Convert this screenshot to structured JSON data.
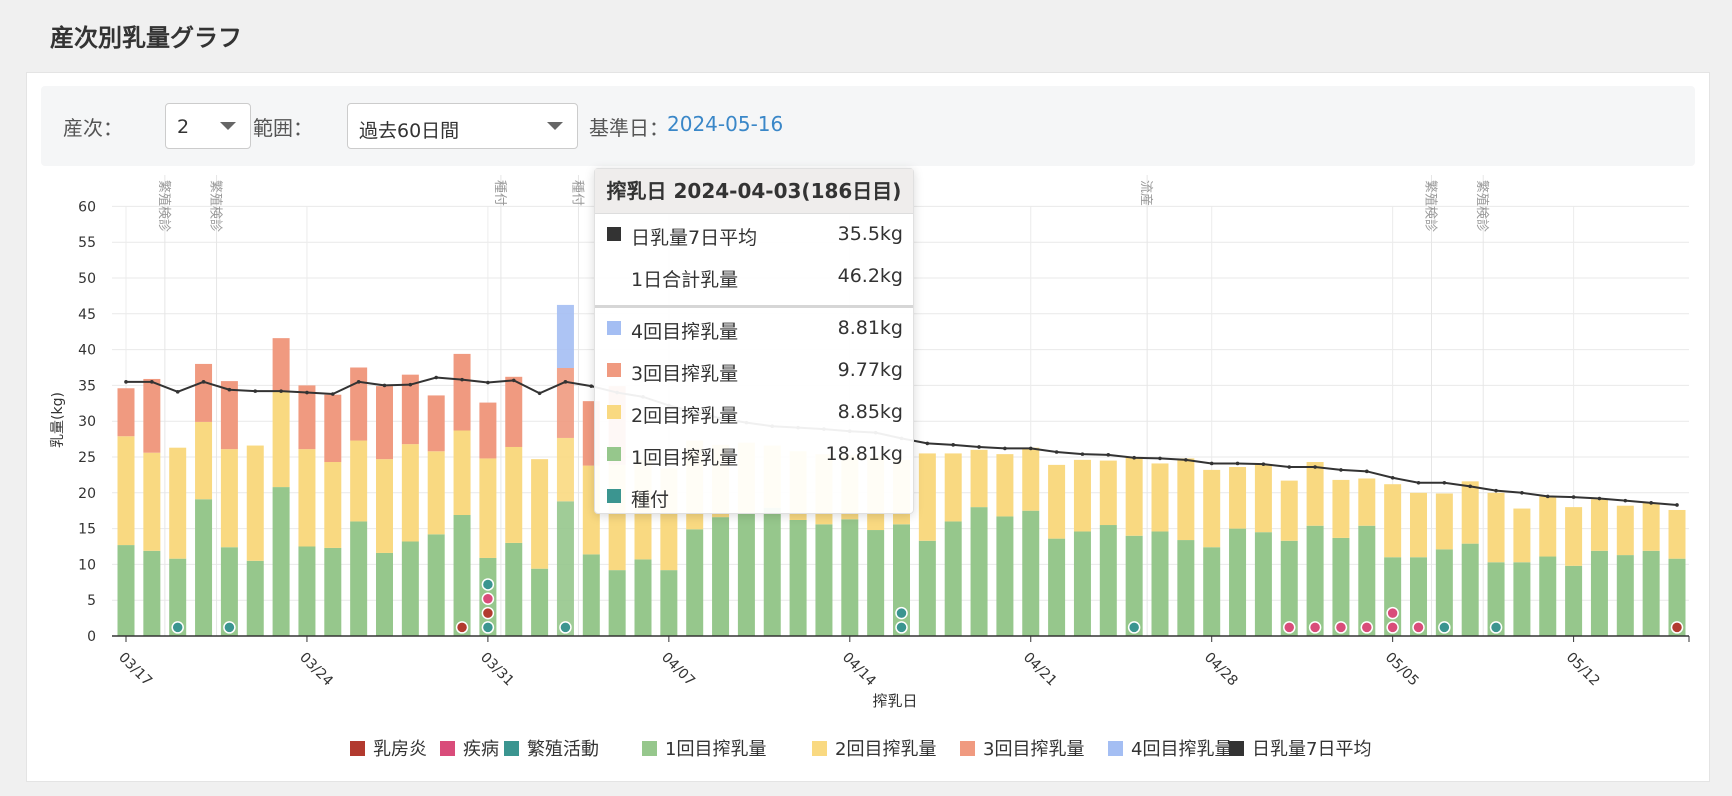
{
  "page_title": "産次別乳量グラフ",
  "filters": {
    "parity_label": "産次：",
    "parity_value": "2",
    "range_label": "範囲：",
    "range_value": "過去60日間",
    "base_date_label": "基準日：",
    "base_date_value": "2024-05-16"
  },
  "tooltip": {
    "title": "搾乳日 2024-04-03(186日目)",
    "rows": [
      {
        "name": "日乳量7日平均",
        "value": "35.5kg",
        "color": "#333333"
      },
      {
        "name": "1日合計乳量",
        "value": "46.2kg",
        "color": ""
      },
      {
        "name": "4回目搾乳量",
        "value": "8.81kg",
        "color": "#a4bef3"
      },
      {
        "name": "3回目搾乳量",
        "value": "9.77kg",
        "color": "#f09a80"
      },
      {
        "name": "2回目搾乳量",
        "value": "8.85kg",
        "color": "#f9d981"
      },
      {
        "name": "1回目搾乳量",
        "value": "18.81kg",
        "color": "#96c78c"
      },
      {
        "name": "種付",
        "value": "",
        "color": "#3b9590"
      }
    ]
  },
  "legend": [
    {
      "name": "乳房炎",
      "color": "#b23a2f"
    },
    {
      "name": "疾病",
      "color": "#d94c7a"
    },
    {
      "name": "繁殖活動",
      "color": "#3b9590"
    },
    {
      "name": "1回目搾乳量",
      "color": "#96c78c"
    },
    {
      "name": "2回目搾乳量",
      "color": "#f9d981"
    },
    {
      "name": "3回目搾乳量",
      "color": "#f09a80"
    },
    {
      "name": "4回目搾乳量",
      "color": "#a4bef3"
    },
    {
      "name": "日乳量7日平均",
      "color": "#333333"
    }
  ],
  "chart_data": {
    "type": "bar",
    "stacked": true,
    "xlabel": "搾乳日",
    "ylabel": "乳量(kg)",
    "ylim": [
      0,
      60
    ],
    "yticks": [
      0,
      5,
      10,
      15,
      20,
      25,
      30,
      35,
      40,
      45,
      50,
      55,
      60
    ],
    "x_tick_labels": [
      "03/17",
      "03/24",
      "03/31",
      "04/07",
      "04/14",
      "04/21",
      "04/28",
      "05/05",
      "05/12"
    ],
    "categories": [
      "03/17",
      "03/18",
      "03/19",
      "03/20",
      "03/21",
      "03/22",
      "03/23",
      "03/24",
      "03/25",
      "03/26",
      "03/27",
      "03/28",
      "03/29",
      "03/30",
      "03/31",
      "04/01",
      "04/02",
      "04/03",
      "04/04",
      "04/05",
      "04/06",
      "04/07",
      "04/08",
      "04/09",
      "04/10",
      "04/11",
      "04/12",
      "04/13",
      "04/14",
      "04/15",
      "04/16",
      "04/17",
      "04/18",
      "04/19",
      "04/20",
      "04/21",
      "04/22",
      "04/23",
      "04/24",
      "04/25",
      "04/26",
      "04/27",
      "04/28",
      "04/29",
      "04/30",
      "05/01",
      "05/02",
      "05/03",
      "05/04",
      "05/05",
      "05/06",
      "05/07",
      "05/08",
      "05/09",
      "05/10",
      "05/11",
      "05/12",
      "05/13",
      "05/14",
      "05/15",
      "05/16"
    ],
    "series": [
      {
        "name": "1回目搾乳量",
        "color": "#96c78c",
        "values": [
          12.7,
          11.9,
          10.8,
          19.1,
          12.4,
          10.5,
          20.8,
          12.5,
          12.3,
          16.0,
          11.6,
          13.2,
          14.2,
          16.9,
          10.9,
          13.0,
          9.4,
          18.81,
          11.4,
          9.2,
          10.7,
          9.2,
          14.9,
          16.6,
          17.2,
          17.9,
          16.2,
          15.6,
          16.3,
          14.8,
          15.6,
          13.3,
          16.0,
          18.0,
          16.7,
          17.5,
          13.6,
          14.6,
          15.5,
          14.0,
          14.6,
          13.4,
          12.4,
          15.0,
          14.5,
          13.3,
          15.4,
          13.7,
          15.4,
          11.0,
          11.0,
          12.1,
          12.9,
          10.3,
          10.3,
          11.1,
          9.8,
          11.9,
          11.3,
          11.9,
          10.8
        ]
      },
      {
        "name": "2回目搾乳量",
        "color": "#f9d981",
        "values": [
          15.2,
          13.7,
          15.5,
          10.8,
          13.7,
          16.1,
          13.5,
          13.6,
          12.0,
          11.3,
          13.1,
          13.6,
          11.6,
          11.8,
          13.9,
          13.4,
          15.3,
          8.85,
          12.4,
          14.7,
          13.9,
          14.2,
          12.4,
          10.1,
          9.8,
          8.7,
          9.6,
          9.8,
          9.0,
          10.2,
          9.0,
          12.2,
          9.5,
          8.0,
          8.7,
          8.8,
          10.3,
          10.0,
          9.0,
          11.0,
          9.5,
          11.4,
          10.8,
          8.6,
          9.5,
          8.4,
          8.9,
          8.1,
          6.6,
          10.2,
          9.0,
          7.8,
          8.7,
          9.7,
          7.5,
          8.4,
          8.2,
          7.2,
          6.9,
          6.7,
          6.8
        ]
      },
      {
        "name": "3回目搾乳量",
        "color": "#f09a80",
        "values": [
          6.7,
          10.3,
          0,
          8.1,
          9.5,
          0,
          7.3,
          8.9,
          9.4,
          10.2,
          10.2,
          9.7,
          7.8,
          10.7,
          7.8,
          9.8,
          0,
          9.77,
          9.0,
          11.0,
          0,
          0,
          0,
          0,
          0,
          0,
          0,
          0,
          0,
          0,
          0,
          0,
          0,
          0,
          0,
          0,
          0,
          0,
          0,
          0,
          0,
          0,
          0,
          0,
          0,
          0,
          0,
          0,
          0,
          0,
          0,
          0,
          0,
          0,
          0,
          0,
          0,
          0,
          0,
          0,
          0
        ]
      },
      {
        "name": "4回目搾乳量",
        "color": "#a4bef3",
        "values": [
          0,
          0,
          0,
          0,
          0,
          0,
          0,
          0,
          0,
          0,
          0,
          0,
          0,
          0,
          0,
          0,
          0,
          8.81,
          0,
          0,
          0,
          0,
          0,
          0,
          0,
          0,
          0,
          0,
          0,
          0,
          0,
          0,
          0,
          0,
          0,
          0,
          0,
          0,
          0,
          0,
          0,
          0,
          0,
          0,
          0,
          0,
          0,
          0,
          0,
          0,
          0,
          0,
          0,
          0,
          0,
          0,
          0,
          0,
          0,
          0,
          0
        ]
      }
    ],
    "avg_7day": [
      35.5,
      35.5,
      34.1,
      35.5,
      34.4,
      34.2,
      34.2,
      34.0,
      33.8,
      35.5,
      35.0,
      35.1,
      36.1,
      35.8,
      35.4,
      35.7,
      33.9,
      35.5,
      34.9,
      34.0,
      33.4,
      32.2,
      31.3,
      30.4,
      29.8,
      29.3,
      29.1,
      28.9,
      28.6,
      28.4,
      27.6,
      26.9,
      26.7,
      26.4,
      26.2,
      26.2,
      25.7,
      25.4,
      25.3,
      24.9,
      24.8,
      24.6,
      24.1,
      24.1,
      24.0,
      23.6,
      23.6,
      23.2,
      23.0,
      22.1,
      21.4,
      21.4,
      20.9,
      20.3,
      20.0,
      19.5,
      19.4,
      19.2,
      18.9,
      18.6,
      18.3
    ],
    "events": [
      {
        "date": "03/19",
        "type": "繁殖活動",
        "y": 1.2
      },
      {
        "date": "03/21",
        "type": "繁殖活動",
        "y": 1.2
      },
      {
        "date": "03/30",
        "type": "乳房炎",
        "y": 1.2
      },
      {
        "date": "03/31",
        "type": "繁殖活動",
        "y": 1.2
      },
      {
        "date": "03/31",
        "type": "乳房炎",
        "y": 3.2
      },
      {
        "date": "03/31",
        "type": "疾病",
        "y": 5.2
      },
      {
        "date": "03/31",
        "type": "繁殖活動",
        "y": 7.2
      },
      {
        "date": "04/03",
        "type": "繁殖活動",
        "y": 1.2
      },
      {
        "date": "04/16",
        "type": "繁殖活動",
        "y": 1.2
      },
      {
        "date": "04/16",
        "type": "繁殖活動",
        "y": 3.2
      },
      {
        "date": "04/25",
        "type": "繁殖活動",
        "y": 1.2
      },
      {
        "date": "05/01",
        "type": "疾病",
        "y": 1.2
      },
      {
        "date": "05/02",
        "type": "疾病",
        "y": 1.2
      },
      {
        "date": "05/03",
        "type": "疾病",
        "y": 1.2
      },
      {
        "date": "05/04",
        "type": "疾病",
        "y": 1.2
      },
      {
        "date": "05/05",
        "type": "疾病",
        "y": 1.2
      },
      {
        "date": "05/05",
        "type": "疾病",
        "y": 3.2
      },
      {
        "date": "05/06",
        "type": "疾病",
        "y": 1.2
      },
      {
        "date": "05/07",
        "type": "繁殖活動",
        "y": 1.2
      },
      {
        "date": "05/09",
        "type": "繁殖活動",
        "y": 1.2
      },
      {
        "date": "05/16",
        "type": "乳房炎",
        "y": 1.2
      }
    ],
    "event_lines": [
      {
        "date": "03/18",
        "label": "繁殖検診"
      },
      {
        "date": "03/20",
        "label": "繁殖検診"
      },
      {
        "date": "03/31",
        "label": "種付"
      },
      {
        "date": "04/03",
        "label": "種付"
      },
      {
        "date": "04/25",
        "label": "流産"
      },
      {
        "date": "05/06",
        "label": "繁殖検診"
      },
      {
        "date": "05/08",
        "label": "繁殖検診"
      }
    ],
    "highlight_date": "04/03"
  }
}
